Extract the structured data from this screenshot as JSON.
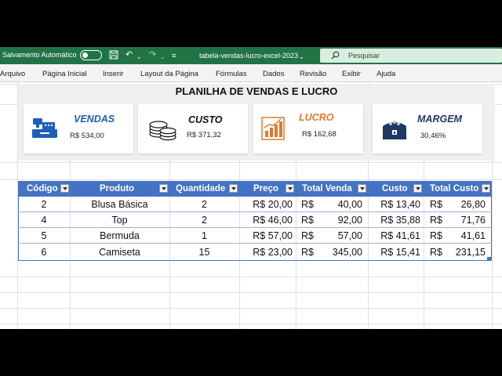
{
  "titlebar": {
    "autosave_label": "Salvamento Automático",
    "filename": "tabela-vendas-lucro-excel-2023",
    "filename_chevron": "⌄",
    "search_placeholder": "Pesquisar"
  },
  "menu": [
    "Arquivo",
    "Página Inicial",
    "Inserir",
    "Layout da Página",
    "Fórmulas",
    "Dados",
    "Revisão",
    "Exibir",
    "Ajuda"
  ],
  "dashboard": {
    "title": "PLANILHA DE VENDAS E LUCRO",
    "cards": [
      {
        "label": "VENDAS",
        "value": "R$ 534,00",
        "color": "#1f5fb8",
        "icon": "cash-register-icon"
      },
      {
        "label": "CUSTO",
        "value": "R$ 371,32",
        "color": "#111111",
        "icon": "coins-icon"
      },
      {
        "label": "LUCRO",
        "value": "R$ 162,68",
        "color": "#e07a2c",
        "icon": "bar-chart-growth-icon"
      },
      {
        "label": "MARGEM",
        "value": "30,46%",
        "color": "#1f3864",
        "icon": "treasure-chest-icon"
      }
    ]
  },
  "table": {
    "headers": [
      "Código",
      "Produto",
      "Quantidade",
      "Preço",
      "Total Venda",
      "Custo",
      "Total Custo"
    ],
    "rows": [
      {
        "codigo": "2",
        "produto": "Blusa Básica",
        "quantidade": "2",
        "preco": "R$ 20,00",
        "total_venda_cur": "R$",
        "total_venda": "40,00",
        "custo": "R$ 13,40",
        "total_custo_cur": "R$",
        "total_custo": "26,80"
      },
      {
        "codigo": "4",
        "produto": "Top",
        "quantidade": "2",
        "preco": "R$ 46,00",
        "total_venda_cur": "R$",
        "total_venda": "92,00",
        "custo": "R$ 35,88",
        "total_custo_cur": "R$",
        "total_custo": "71,76"
      },
      {
        "codigo": "5",
        "produto": "Bermuda",
        "quantidade": "1",
        "preco": "R$ 57,00",
        "total_venda_cur": "R$",
        "total_venda": "57,00",
        "custo": "R$ 41,61",
        "total_custo_cur": "R$",
        "total_custo": "41,61"
      },
      {
        "codigo": "6",
        "produto": "Camiseta",
        "quantidade": "15",
        "preco": "R$ 23,00",
        "total_venda_cur": "R$",
        "total_venda": "345,00",
        "custo": "R$ 15,41",
        "total_custo_cur": "R$",
        "total_custo": "231,15"
      }
    ],
    "header_color": "#4472c4"
  },
  "colors": {
    "excel_green": "#217346"
  }
}
